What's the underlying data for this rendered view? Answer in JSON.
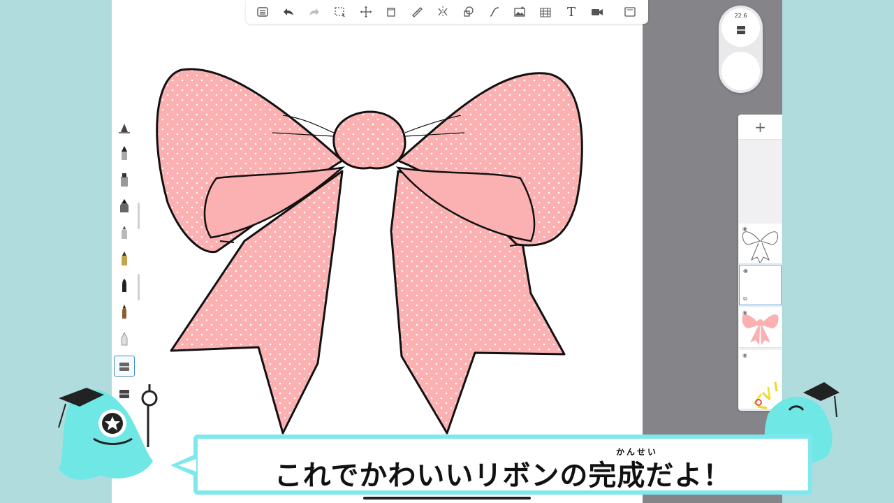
{
  "app": {
    "colors": {
      "background": "#b0dcde",
      "canvas": "#ffffff",
      "workspace": "#858489",
      "ribbon_fill": "#fbb0b2",
      "ribbon_outline": "#111111",
      "caption_border": "#7ee8ee",
      "selection": "#4aa5e0"
    }
  },
  "toolbar": {
    "items": [
      {
        "name": "menu-list-icon"
      },
      {
        "name": "undo-icon"
      },
      {
        "name": "redo-icon",
        "disabled": true
      },
      {
        "name": "selection-icon"
      },
      {
        "name": "transform-icon"
      },
      {
        "name": "fill-bucket-icon"
      },
      {
        "name": "ruler-icon"
      },
      {
        "name": "symmetry-icon"
      },
      {
        "name": "shape-icon"
      },
      {
        "name": "curve-icon"
      },
      {
        "name": "image-icon"
      },
      {
        "name": "perspective-grid-icon"
      },
      {
        "name": "text-icon",
        "label": "T"
      },
      {
        "name": "video-icon"
      },
      {
        "name": "fullscreen-icon"
      }
    ]
  },
  "brush_control": {
    "size_value": "22.6"
  },
  "layers": {
    "add_label": "+",
    "items": [
      {
        "name": "layer-outline",
        "visible": true
      },
      {
        "name": "layer-empty",
        "visible": true,
        "selected": true
      },
      {
        "name": "layer-pink-ribbon",
        "visible": true
      },
      {
        "name": "layer-blank",
        "visible": true
      },
      {
        "name": "layer-colors",
        "visible": true
      }
    ]
  },
  "caption": {
    "text": "これでかわいいリボンの完成だよ！",
    "furigana": "かんせい"
  }
}
